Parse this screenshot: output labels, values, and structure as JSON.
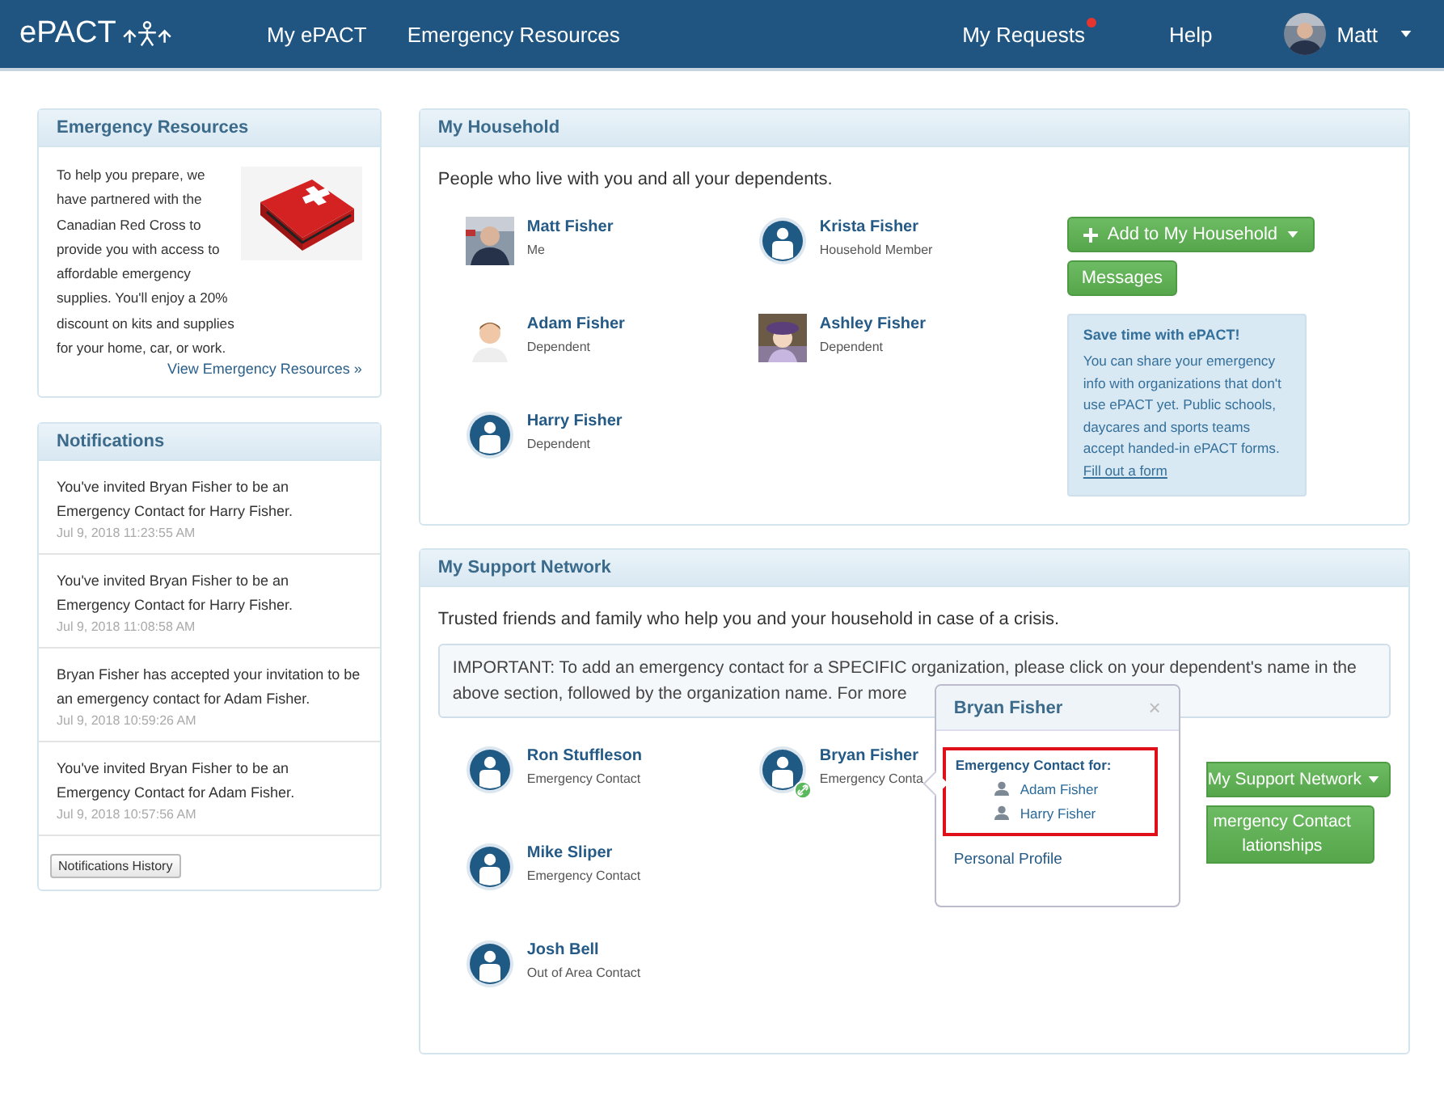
{
  "nav": {
    "logo": "ePACT",
    "links": [
      {
        "label": "My ePACT"
      },
      {
        "label": "Emergency Resources"
      }
    ],
    "requests": {
      "label": "My Requests",
      "alert": true
    },
    "help": "Help",
    "user": "Matt"
  },
  "resources": {
    "title": "Emergency Resources",
    "body": "To help you prepare, we have partnered with the Canadian Red Cross to provide you with access to affordable emergency supplies. You'll enjoy a 20% discount on kits and supplies for your home, car, or work.",
    "link": "View Emergency Resources »"
  },
  "notifications": {
    "title": "Notifications",
    "items": [
      {
        "text": "You've invited Bryan Fisher to be an Emergency Contact for Harry Fisher.",
        "time": "Jul 9, 2018 11:23:55 AM"
      },
      {
        "text": "You've invited Bryan Fisher to be an Emergency Contact for Harry Fisher.",
        "time": "Jul 9, 2018 11:08:58 AM"
      },
      {
        "text": "Bryan Fisher has accepted your invitation to be an emergency contact for Adam Fisher.",
        "time": "Jul 9, 2018 10:59:26 AM"
      },
      {
        "text": "You've invited Bryan Fisher to be an Emergency Contact for Adam Fisher.",
        "time": "Jul 9, 2018 10:57:56 AM"
      }
    ],
    "history_button": "Notifications History"
  },
  "household": {
    "title": "My Household",
    "intro": "People who live with you and all your dependents.",
    "members": [
      {
        "name": "Matt Fisher",
        "role": "Me",
        "photo": true
      },
      {
        "name": "Krista Fisher",
        "role": "Household Member",
        "photo": false
      },
      {
        "name": "Adam Fisher",
        "role": "Dependent",
        "photo": true
      },
      {
        "name": "Ashley Fisher",
        "role": "Dependent",
        "photo": true
      },
      {
        "name": "Harry Fisher",
        "role": "Dependent",
        "photo": false
      }
    ],
    "add_button": "Add to My Household",
    "messages_button": "Messages",
    "tip": {
      "title": "Save time with ePACT!",
      "body": "You can share your emergency info with organizations that don't use ePACT yet. Public schools, daycares and sports teams accept handed-in ePACT forms.",
      "link": "Fill out a form"
    }
  },
  "support": {
    "title": "My Support Network",
    "intro": "Trusted friends and family who help you and your household in case of a crisis.",
    "important": "IMPORTANT: To add an emergency contact for a SPECIFIC organization, please click on your dependent's name in the above section, followed by the organization name. For more",
    "contacts": [
      {
        "name": "Ron Stuffleson",
        "role": "Emergency Contact",
        "photo": false,
        "linked": false
      },
      {
        "name": "Bryan Fisher",
        "role": "Emergency Conta",
        "photo": false,
        "linked": true
      },
      {
        "name": "Mike Sliper",
        "role": "Emergency Contact",
        "photo": false,
        "linked": false
      },
      {
        "name": "Josh Bell",
        "role": "Out of Area Contact",
        "photo": false,
        "linked": false
      }
    ],
    "buttons": [
      {
        "label": "My Support Network",
        "caret": true
      },
      {
        "label": "mergency Contact lationships",
        "caret": false
      }
    ],
    "popover": {
      "title": "Bryan Fisher",
      "close": "×",
      "heading": "Emergency Contact for:",
      "people": [
        "Adam Fisher",
        "Harry Fisher"
      ],
      "profile_link": "Personal Profile"
    }
  }
}
